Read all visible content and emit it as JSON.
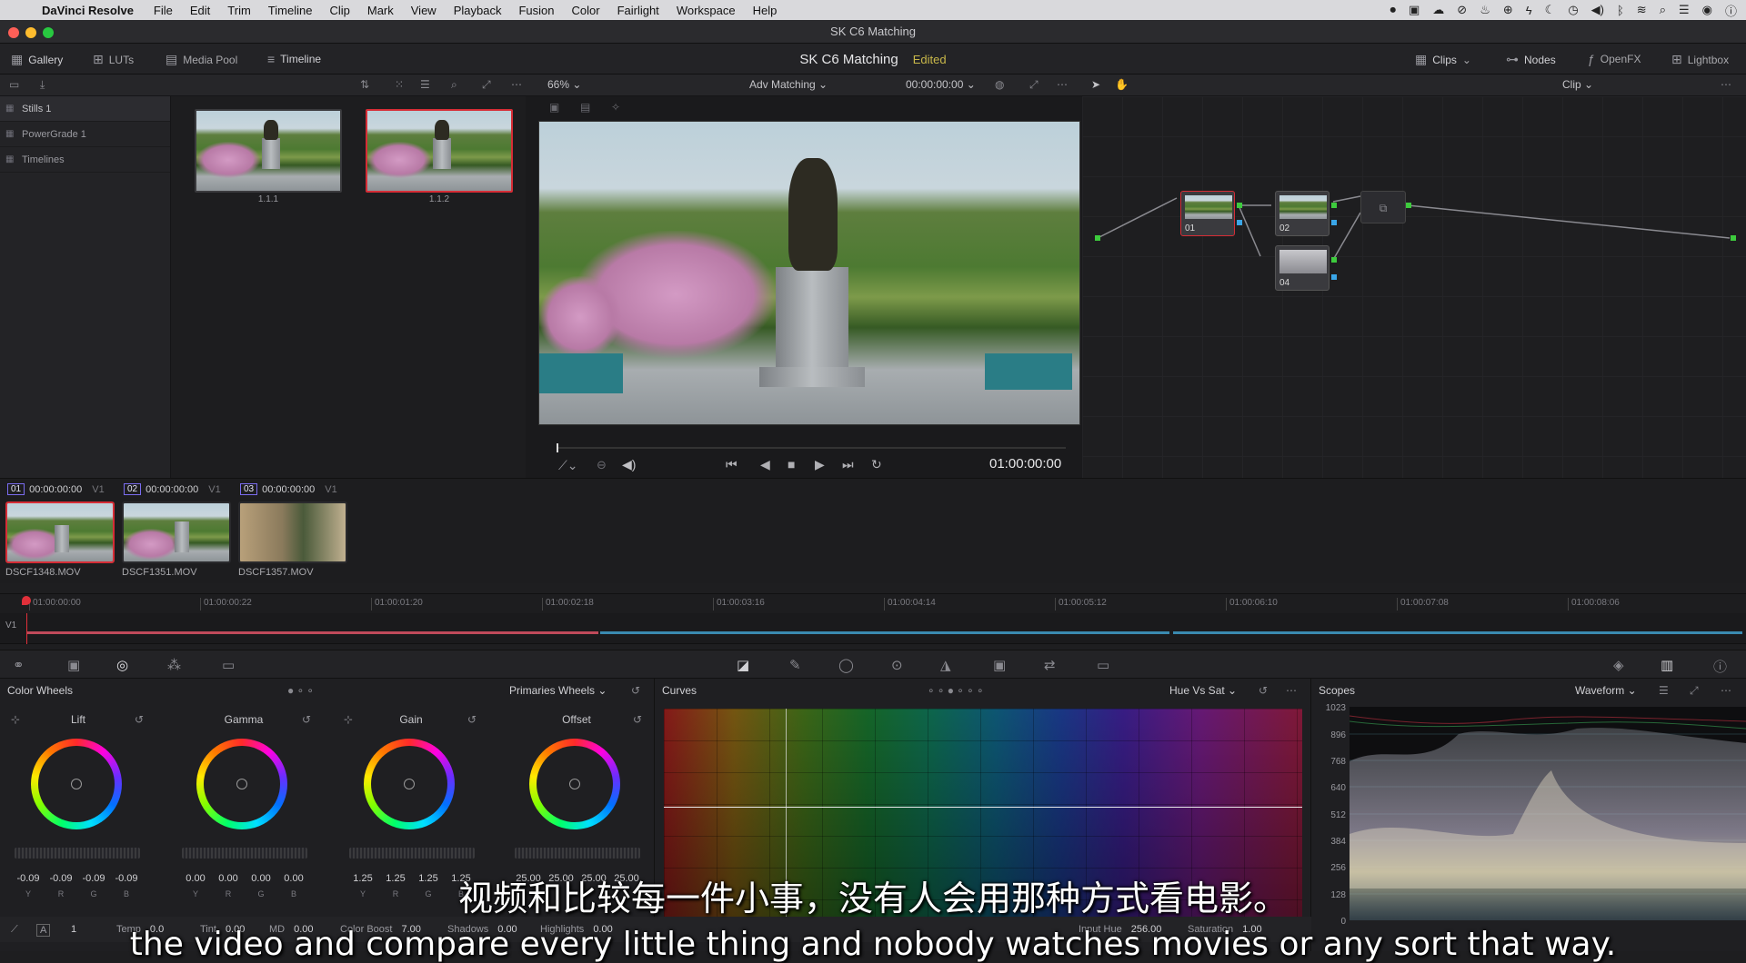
{
  "menubar": {
    "app_name": "DaVinci Resolve",
    "items": [
      "File",
      "Edit",
      "Trim",
      "Timeline",
      "Clip",
      "Mark",
      "View",
      "Playback",
      "Fusion",
      "Color",
      "Fairlight",
      "Workspace",
      "Help"
    ]
  },
  "window": {
    "title": "SK C6 Matching"
  },
  "toolbar": {
    "left": [
      {
        "icon": "gallery-icon",
        "label": "Gallery"
      },
      {
        "icon": "luts-icon",
        "label": "LUTs"
      },
      {
        "icon": "media-pool-icon",
        "label": "Media Pool"
      },
      {
        "icon": "timeline-icon",
        "label": "Timeline"
      }
    ],
    "project": "SK C6 Matching",
    "status": "Edited",
    "right": [
      {
        "icon": "clips-icon",
        "label": "Clips"
      },
      {
        "icon": "nodes-icon",
        "label": "Nodes"
      },
      {
        "icon": "openfx-icon",
        "label": "OpenFX"
      },
      {
        "icon": "lightbox-icon",
        "label": "Lightbox"
      }
    ]
  },
  "viewer_bar": {
    "zoom": "66%",
    "mode": "Adv Matching",
    "timecode": "00:00:00:00",
    "node_mode": "Clip"
  },
  "sidebar": {
    "items": [
      "Stills 1",
      "PowerGrade 1",
      "Timelines"
    ]
  },
  "gallery": {
    "stills": [
      {
        "label": "1.1.1",
        "selected": false
      },
      {
        "label": "1.1.2",
        "selected": true
      }
    ]
  },
  "viewer": {
    "timecode": "01:00:00:00"
  },
  "nodes": [
    {
      "label": "01",
      "selected": true
    },
    {
      "label": "02",
      "selected": false
    },
    {
      "label": "04",
      "selected": false
    }
  ],
  "clips": [
    {
      "num": "01",
      "tc": "00:00:00:00",
      "track": "V1",
      "name": "DSCF1348.MOV",
      "selected": true
    },
    {
      "num": "02",
      "tc": "00:00:00:00",
      "track": "V1",
      "name": "DSCF1351.MOV",
      "selected": false
    },
    {
      "num": "03",
      "tc": "00:00:00:00",
      "track": "V1",
      "name": "DSCF1357.MOV",
      "selected": false
    }
  ],
  "ruler": {
    "ticks": [
      "01:00:00:00",
      "01:00:00:22",
      "01:00:01:20",
      "01:00:02:18",
      "01:00:03:16",
      "01:00:04:14",
      "01:00:05:12",
      "01:00:06:10",
      "01:00:07:08",
      "01:00:08:06"
    ],
    "track": "V1"
  },
  "color_wheels": {
    "title": "Color Wheels",
    "mode": "Primaries Wheels",
    "wheels": [
      {
        "name": "Lift",
        "values": [
          "-0.09",
          "-0.09",
          "-0.09",
          "-0.09"
        ]
      },
      {
        "name": "Gamma",
        "values": [
          "0.00",
          "0.00",
          "0.00",
          "0.00"
        ]
      },
      {
        "name": "Gain",
        "values": [
          "1.25",
          "1.25",
          "1.25",
          "1.25"
        ]
      },
      {
        "name": "Offset",
        "values": [
          "25.00",
          "25.00",
          "25.00",
          "25.00"
        ]
      }
    ],
    "channels": [
      "Y",
      "R",
      "G",
      "B"
    ]
  },
  "curves": {
    "title": "Curves",
    "mode": "Hue Vs Sat"
  },
  "scopes": {
    "title": "Scopes",
    "mode": "Waveform",
    "labels": [
      "1023",
      "896",
      "768",
      "640",
      "512",
      "384",
      "256",
      "128",
      "0"
    ]
  },
  "footer": {
    "page": "1",
    "fields": [
      {
        "label": "Temp",
        "value": "0.0"
      },
      {
        "label": "Tint",
        "value": "0.00"
      },
      {
        "label": "MD",
        "value": "0.00"
      },
      {
        "label": "Color Boost",
        "value": "7.00"
      },
      {
        "label": "Shadows",
        "value": "0.00"
      },
      {
        "label": "Highlights",
        "value": "0.00"
      }
    ],
    "right_fields": [
      {
        "label": "Input Hue",
        "value": "256.00"
      },
      {
        "label": "Saturation",
        "value": "1.00"
      }
    ]
  },
  "subtitles": {
    "zh": "视频和比较每一件小事，没有人会用那种方式看电影。",
    "en": "the video and compare every little thing and nobody watches movies or any sort that way."
  }
}
